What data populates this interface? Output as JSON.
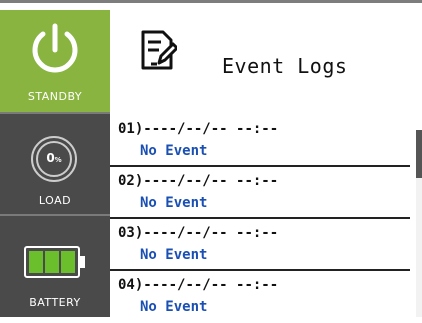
{
  "sidebar": {
    "standby": {
      "label": "STANDBY",
      "icon": "power-icon"
    },
    "load": {
      "label": "LOAD",
      "value": "0",
      "unit": "%",
      "icon": "load-gauge-icon"
    },
    "battery": {
      "label": "BATTERY",
      "icon": "battery-icon",
      "level_percent": 100
    }
  },
  "header": {
    "title": "Event Logs",
    "icon": "log-edit-icon"
  },
  "events": [
    {
      "index": "01)",
      "timestamp": "----/--/-- --:--",
      "status": "No Event"
    },
    {
      "index": "02)",
      "timestamp": "----/--/-- --:--",
      "status": "No Event"
    },
    {
      "index": "03)",
      "timestamp": "----/--/-- --:--",
      "status": "No Event"
    },
    {
      "index": "04)",
      "timestamp": "----/--/-- --:--",
      "status": "No Event"
    }
  ],
  "colors": {
    "standby_bg": "#88b43f",
    "sidebar_bg": "#4a4a4a",
    "event_status": "#1a4fb3",
    "battery_cells": "#6cbf2c"
  }
}
